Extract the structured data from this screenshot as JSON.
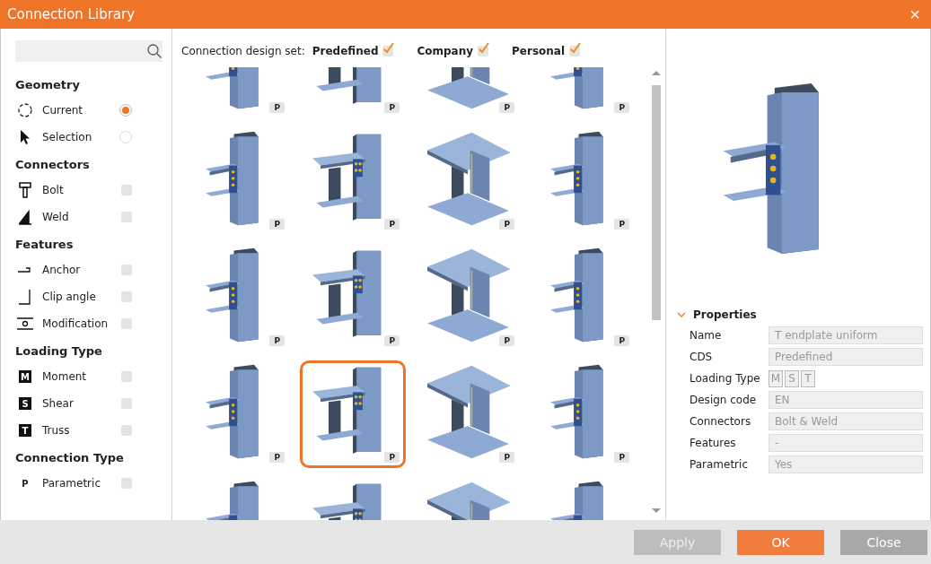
{
  "window": {
    "title": "Connection Library",
    "close": "×"
  },
  "filters": [
    {
      "heading": "Geometry",
      "items": [
        {
          "label": "Current",
          "kind": "radio",
          "selected": true
        },
        {
          "label": "Selection",
          "kind": "radio",
          "selected": false
        }
      ]
    },
    {
      "heading": "Connectors",
      "items": [
        {
          "label": "Bolt",
          "kind": "check",
          "checked": false
        },
        {
          "label": "Weld",
          "kind": "check",
          "checked": false
        }
      ]
    },
    {
      "heading": "Features",
      "items": [
        {
          "label": "Anchor",
          "kind": "check",
          "checked": false
        },
        {
          "label": "Clip angle",
          "kind": "check",
          "checked": false
        },
        {
          "label": "Modification",
          "kind": "check",
          "checked": false
        }
      ]
    },
    {
      "heading": "Loading Type",
      "items": [
        {
          "label": "Moment",
          "kind": "check",
          "checked": false,
          "badge": "M"
        },
        {
          "label": "Shear",
          "kind": "check",
          "checked": false,
          "badge": "S"
        },
        {
          "label": "Truss",
          "kind": "check",
          "checked": false,
          "badge": "T"
        }
      ]
    },
    {
      "heading": "Connection Type",
      "items": [
        {
          "label": "Parametric",
          "kind": "check",
          "checked": false,
          "badge": "P"
        }
      ]
    }
  ],
  "design_set": {
    "label": "Connection design set:",
    "options": [
      {
        "label": "Predefined",
        "checked": true
      },
      {
        "label": "Company",
        "checked": true
      },
      {
        "label": "Personal",
        "checked": true
      }
    ]
  },
  "thumbnails": [
    {
      "badge": "P",
      "selected": false
    },
    {
      "badge": "P",
      "selected": false
    },
    {
      "badge": "P",
      "selected": false
    },
    {
      "badge": "P",
      "selected": false
    },
    {
      "badge": "P",
      "selected": false
    },
    {
      "badge": "P",
      "selected": false
    },
    {
      "badge": "P",
      "selected": false
    },
    {
      "badge": "P",
      "selected": false
    },
    {
      "badge": "P",
      "selected": false
    },
    {
      "badge": "P",
      "selected": false
    },
    {
      "badge": "P",
      "selected": false
    },
    {
      "badge": "P",
      "selected": false
    },
    {
      "badge": "P",
      "selected": false
    },
    {
      "badge": "P",
      "selected": true
    },
    {
      "badge": "P",
      "selected": false
    },
    {
      "badge": "P",
      "selected": false
    },
    {
      "selected": false
    },
    {
      "selected": false
    },
    {
      "selected": false
    },
    {
      "selected": false
    }
  ],
  "properties": {
    "heading": "Properties",
    "expanded": true,
    "rows": [
      {
        "label": "Name",
        "kind": "field",
        "value": "T endplate uniform"
      },
      {
        "label": "CDS",
        "kind": "field",
        "value": "Predefined"
      },
      {
        "label": "Loading Type",
        "kind": "toggles",
        "toggles": [
          "M",
          "S",
          "T"
        ]
      },
      {
        "label": "Design code",
        "kind": "field",
        "value": "EN"
      },
      {
        "label": "Connectors",
        "kind": "field",
        "value": "Bolt & Weld"
      },
      {
        "label": "Features",
        "kind": "field",
        "value": "-"
      },
      {
        "label": "Parametric",
        "kind": "field",
        "value": "Yes"
      }
    ]
  },
  "buttons": [
    {
      "label": "Apply",
      "kind": "secondary",
      "disabled": true
    },
    {
      "label": "OK",
      "kind": "primary",
      "disabled": false
    },
    {
      "label": "Close",
      "kind": "secondary",
      "disabled": false
    }
  ]
}
